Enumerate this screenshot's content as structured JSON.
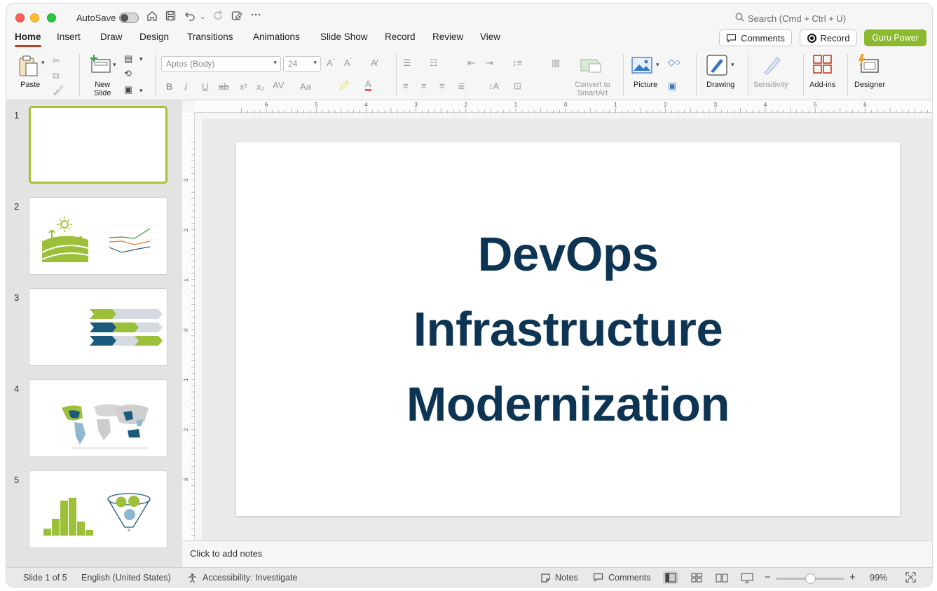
{
  "titlebar": {
    "autosave_label": "AutoSave",
    "search_placeholder": "Search (Cmd + Ctrl + U)"
  },
  "tabs": [
    {
      "label": "Home",
      "active": true
    },
    {
      "label": "Insert"
    },
    {
      "label": "Draw"
    },
    {
      "label": "Design"
    },
    {
      "label": "Transitions"
    },
    {
      "label": "Animations"
    },
    {
      "label": "Slide Show"
    },
    {
      "label": "Record"
    },
    {
      "label": "Review"
    },
    {
      "label": "View"
    }
  ],
  "header_buttons": {
    "comments": "Comments",
    "record": "Record",
    "guru": "Guru Power"
  },
  "ribbon": {
    "paste": "Paste",
    "new_slide": "New\nSlide",
    "font_name": "Aptos (Body)",
    "font_size": "24",
    "convert_smartart": "Convert to\nSmartArt",
    "picture": "Picture",
    "drawing": "Drawing",
    "sensitivity": "Sensitivity",
    "addins": "Add-ins",
    "designer": "Designer"
  },
  "slides": [
    {
      "number": "1",
      "selected": true
    },
    {
      "number": "2"
    },
    {
      "number": "3"
    },
    {
      "number": "4"
    },
    {
      "number": "5"
    }
  ],
  "slide": {
    "title_lines": [
      "DevOps",
      "Infrastructure",
      "Modernization"
    ]
  },
  "notes_placeholder": "Click to add notes",
  "status": {
    "slide_count": "Slide 1 of 5",
    "language": "English (United States)",
    "accessibility": "Accessibility: Investigate",
    "notes": "Notes",
    "comments": "Comments",
    "zoom": "99%"
  },
  "ruler": {
    "h_labels": [
      "6",
      "5",
      "4",
      "3",
      "2",
      "1",
      "0",
      "1",
      "2",
      "3",
      "4",
      "5",
      "6"
    ],
    "v_labels": [
      "3",
      "2",
      "1",
      "0",
      "1",
      "2",
      "3"
    ]
  },
  "colors": {
    "accent": "#c43e1c",
    "guru": "#8cba2e",
    "title_text": "#0d3553",
    "thumb_green": "#9dc03a",
    "thumb_blue": "#1b5a7c"
  }
}
